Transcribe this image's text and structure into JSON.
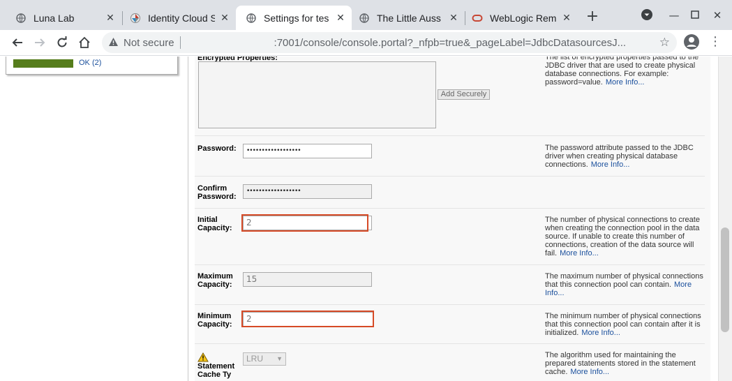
{
  "browser": {
    "tabs": [
      {
        "title": "Luna Lab",
        "icon": "globe-icon",
        "active": false
      },
      {
        "title": "Identity Cloud S",
        "icon": "identity-cloud-icon",
        "active": false
      },
      {
        "title": "Settings for tes",
        "icon": "globe-icon",
        "active": true
      },
      {
        "title": "The Little Auss",
        "icon": "globe-icon",
        "active": false
      },
      {
        "title": "WebLogic Rem",
        "icon": "oracle-icon",
        "active": false
      }
    ],
    "new_tab": "+",
    "security_label": "Not secure",
    "url": ":7001/console/console.portal?_nfpb=true&_pageLabel=JdbcDatasourcesJ..."
  },
  "health": {
    "label": "OK (2)",
    "color": "#567d1c"
  },
  "form": {
    "encrypted": {
      "label": "Encrypted Properties:",
      "button": "Add Securely",
      "help": "The list of encrypted properties passed to the JDBC driver that are used to create physical database connections. For example: password=value.",
      "more": "More Info..."
    },
    "password": {
      "label": "Password:",
      "value": "••••••••••••••••••",
      "help": "The password attribute passed to the JDBC driver when creating physical database connections.",
      "more": "More Info..."
    },
    "confirm_password": {
      "label": "Confirm Password:",
      "value": "••••••••••••••••••"
    },
    "initial_capacity": {
      "label": "Initial Capacity:",
      "value": "2",
      "help": "The number of physical connections to create when creating the connection pool in the data source. If unable to create this number of connections, creation of the data source will fail.",
      "more": "More Info..."
    },
    "maximum_capacity": {
      "label": "Maximum Capacity:",
      "value": "15",
      "help": "The maximum number of physical connections that this connection pool can contain.",
      "more": "More Info..."
    },
    "minimum_capacity": {
      "label": "Minimum Capacity:",
      "value": "2",
      "help": "The minimum number of physical connections that this connection pool can contain after it is initialized.",
      "more": "More Info..."
    },
    "statement_cache": {
      "label": "Statement Cache Ty",
      "value": "LRU",
      "help": "The algorithm used for maintaining the prepared statements stored in the statement cache.",
      "more": "More Info..."
    }
  },
  "colors": {
    "highlight": "#d64a26",
    "link": "#1a4f9c"
  }
}
